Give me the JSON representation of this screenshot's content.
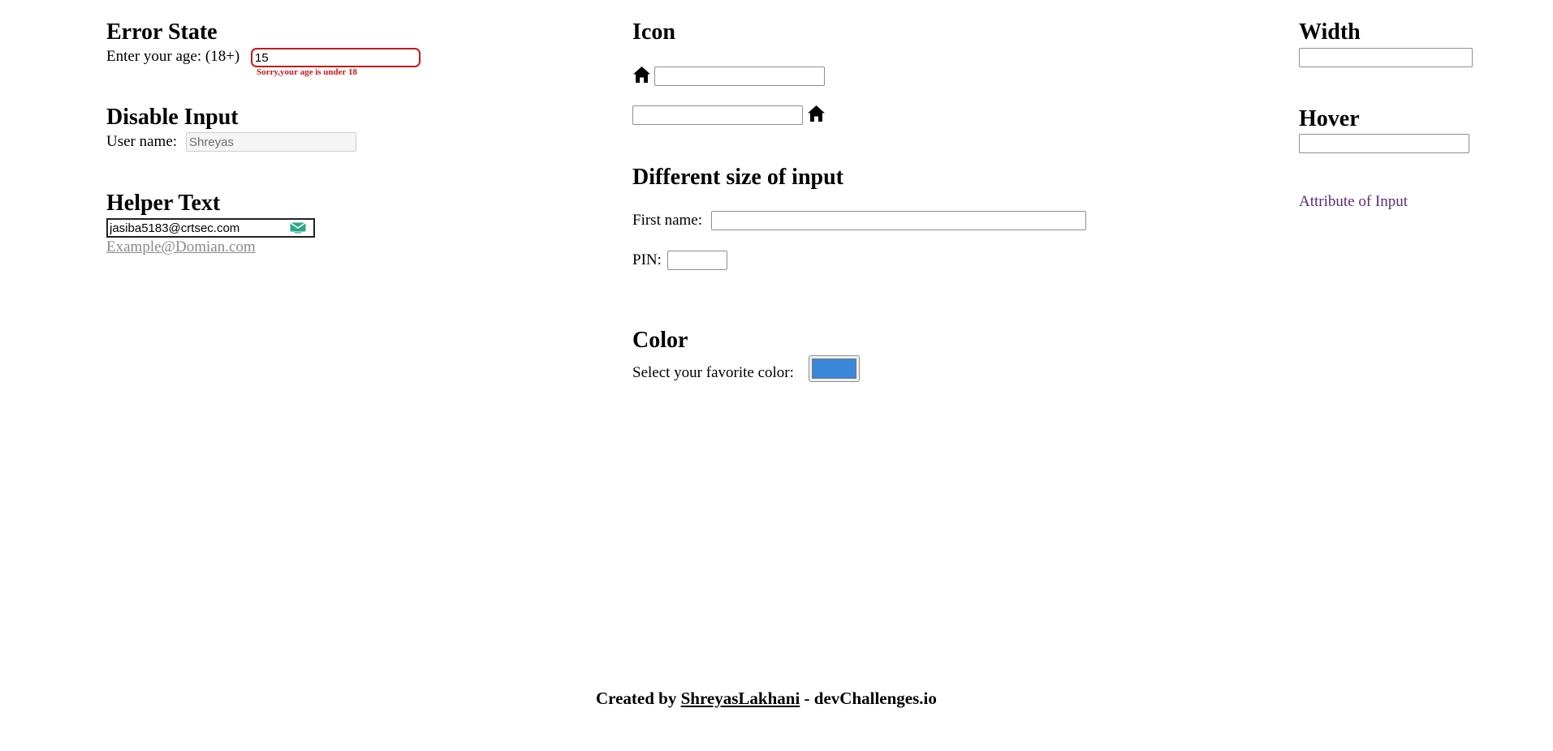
{
  "error_state": {
    "title": "Error State",
    "label": "Enter your age: (18+)",
    "value": "15",
    "error_message": "Sorry,your age is under 18"
  },
  "disable_input": {
    "title": "Disable Input",
    "label": "User name:",
    "value": "Shreyas"
  },
  "helper_text": {
    "title": "Helper Text",
    "value": "jasiba5183@crtsec.com",
    "icon": "mail-icon",
    "helper": "Example@Domian.com"
  },
  "icon_section": {
    "title": "Icon",
    "icon": "home-icon",
    "input1_value": "",
    "input2_value": ""
  },
  "sizes": {
    "title": "Different size of input",
    "first_name_label": "First name:",
    "pin_label": "PIN:"
  },
  "color": {
    "title": "Color",
    "label": "Select your favorite color:",
    "value": "#3a87d9"
  },
  "width": {
    "title": "Width"
  },
  "hover": {
    "title": "Hover"
  },
  "attribute_link": "Attribute of Input",
  "footer": {
    "prefix": "Created by",
    "author": "ShreyasLakhani",
    "suffix": "- devChallenges.io"
  }
}
